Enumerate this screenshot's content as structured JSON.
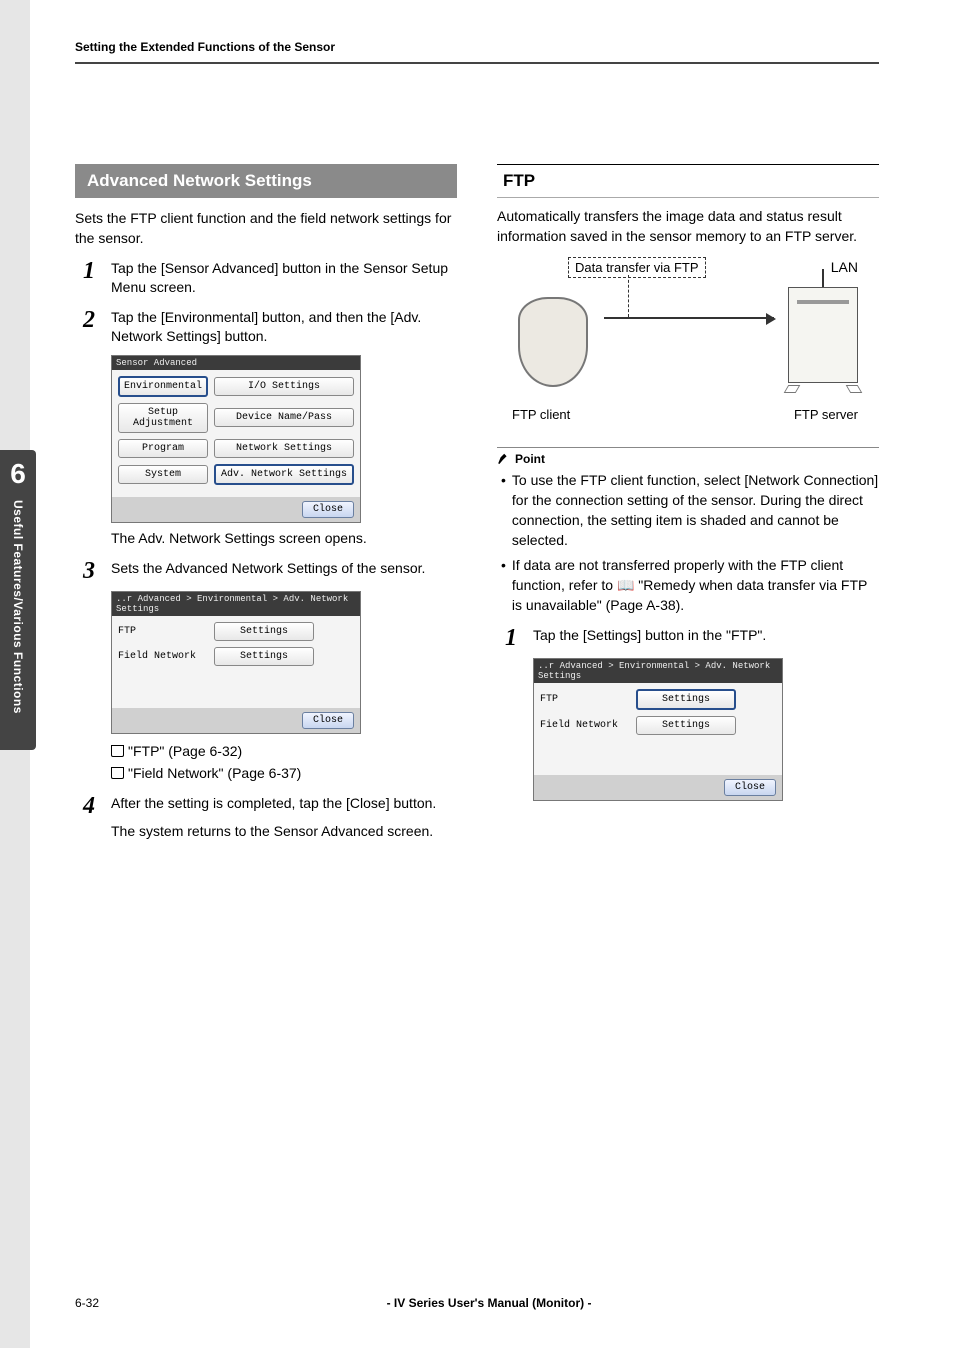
{
  "running_header": "Setting the Extended Functions of the Sensor",
  "chapter_tab": {
    "number": "6",
    "label": "Useful Features/Various Functions"
  },
  "left": {
    "banner": "Advanced Network Settings",
    "intro": "Sets the FTP client function and the field network settings for the sensor.",
    "steps": [
      {
        "num": "1",
        "text": "Tap the [Sensor Advanced] button in the Sensor Setup Menu screen."
      },
      {
        "num": "2",
        "text": "Tap the [Environmental] button, and then the [Adv. Network Settings] button."
      }
    ],
    "shot1": {
      "title": "Sensor Advanced",
      "rows": [
        {
          "label": "Environmental",
          "btn": "I/O Settings",
          "hl_label": true
        },
        {
          "label": "Setup Adjustment",
          "btn": "Device Name/Pass"
        },
        {
          "label": "Program",
          "btn": "Network Settings"
        },
        {
          "label": "System",
          "btn": "Adv. Network Settings",
          "hl_btn": true
        }
      ],
      "close": "Close"
    },
    "note_after_shot1": "The Adv. Network Settings screen opens.",
    "step3": {
      "num": "3",
      "text": "Sets the Advanced Network Settings of the sensor."
    },
    "shot2": {
      "title": "..r Advanced > Environmental > Adv. Network Settings",
      "rows": [
        {
          "label": "FTP",
          "btn": "Settings"
        },
        {
          "label": "Field Network",
          "btn": "Settings"
        }
      ],
      "close": "Close"
    },
    "xref1": "\"FTP\" (Page 6-32)",
    "xref2": "\"Field Network\" (Page 6-37)",
    "step4": {
      "num": "4",
      "text": "After the setting is completed, tap the [Close] button."
    },
    "note_after_step4": "The system returns to the Sensor Advanced screen."
  },
  "right": {
    "heading": "FTP",
    "intro": "Automatically transfers the image data and status result information saved in the sensor memory to an FTP server.",
    "diagram": {
      "top_label": "Data transfer via FTP",
      "lan": "LAN",
      "client_cap": "FTP client",
      "server_cap": "FTP server"
    },
    "point_label": "Point",
    "bullets": [
      "To use the FTP client function, select [Network Connection] for the connection setting of the sensor. During the direct connection, the setting item is shaded and cannot be selected.",
      "If data are not transferred properly with the FTP client function, refer to 📖 \"Remedy when data transfer via FTP is unavailable\" (Page A-38)."
    ],
    "step1": {
      "num": "1",
      "text": "Tap the [Settings] button in the \"FTP\"."
    },
    "shot": {
      "title": "..r Advanced > Environmental > Adv. Network Settings",
      "rows": [
        {
          "label": "FTP",
          "btn": "Settings",
          "hl_btn": true
        },
        {
          "label": "Field Network",
          "btn": "Settings"
        }
      ],
      "close": "Close"
    }
  },
  "footer": {
    "page": "6-32",
    "center": "- IV Series User's Manual (Monitor) -"
  }
}
